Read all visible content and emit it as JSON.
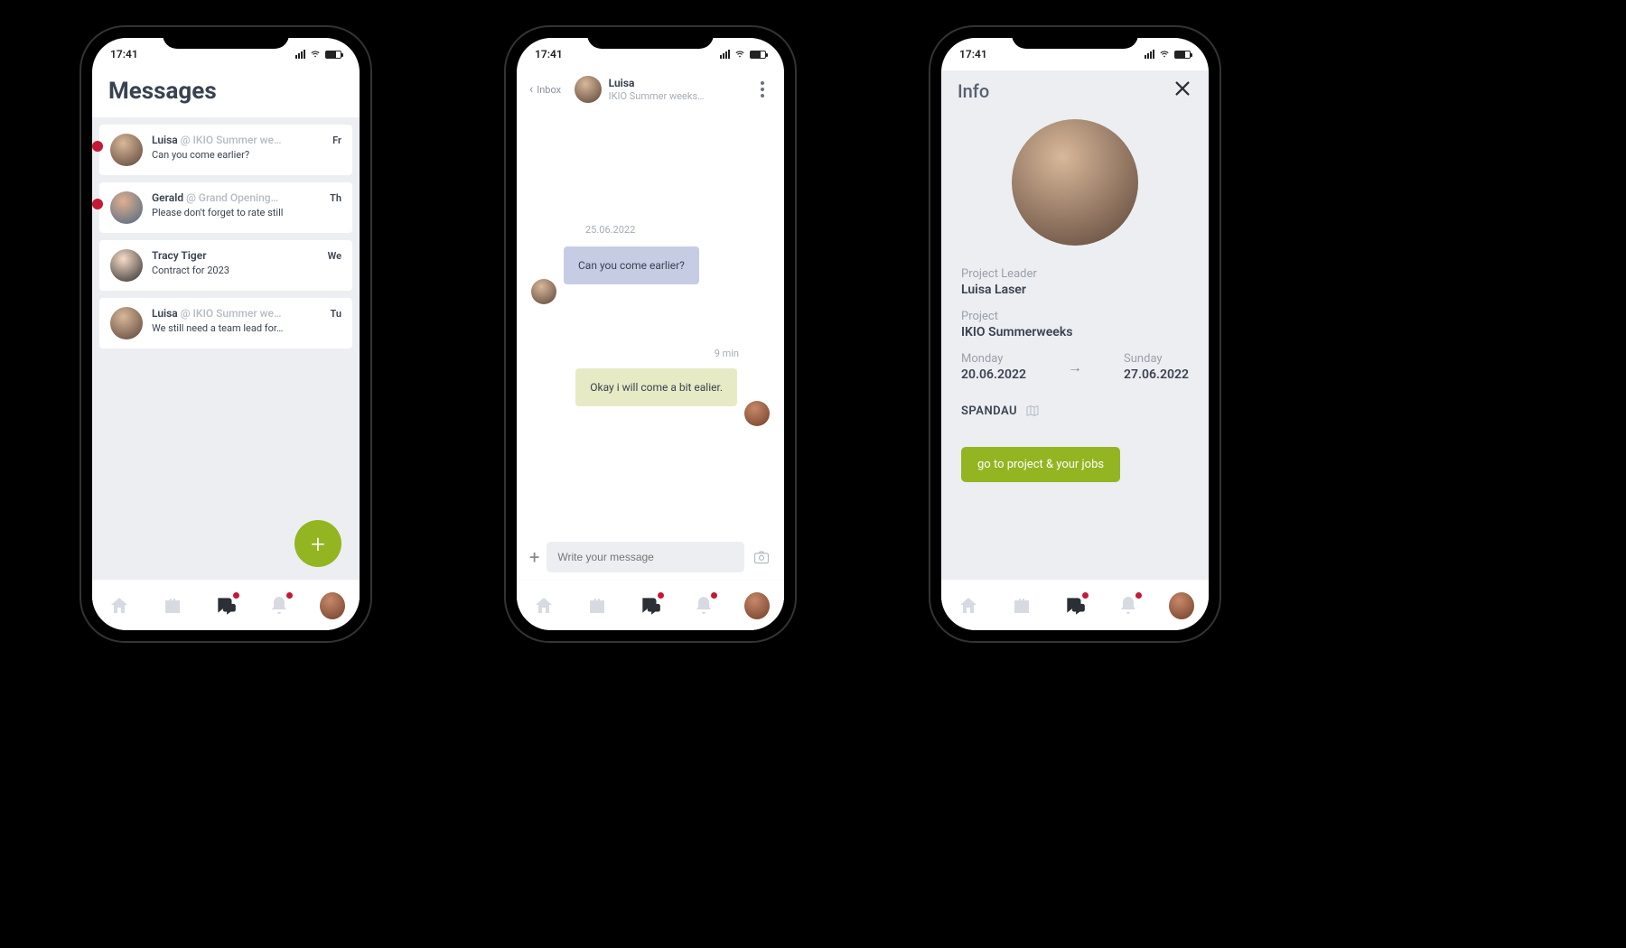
{
  "status_time": "17:41",
  "phone1": {
    "title": "Messages",
    "fab_icon": "+",
    "messages": [
      {
        "name": "Luisa",
        "context": "@ IKIO Summer we…",
        "day": "Fr",
        "preview": "Can you come earlier?",
        "unread": true,
        "avatar": "luisa"
      },
      {
        "name": "Gerald",
        "context": "@ Grand Opening…",
        "day": "Th",
        "preview": "Please don't forget to rate still",
        "unread": true,
        "avatar": "gerald"
      },
      {
        "name": "Tracy Tiger",
        "context": "",
        "day": "We",
        "preview": "Contract for 2023",
        "unread": false,
        "avatar": "tracy"
      },
      {
        "name": "Luisa",
        "context": "@ IKIO Summer we…",
        "day": "Tu",
        "preview": "We still need a team lead for…",
        "unread": false,
        "avatar": "luisa"
      }
    ]
  },
  "phone2": {
    "back_label": "Inbox",
    "user_name": "Luisa",
    "user_sub": "IKIO Summer weeks…",
    "date_label": "25.06.2022",
    "bubble1": "Can you come earlier?",
    "time_label": "9 min",
    "bubble2": "Okay i will come a bit ealier.",
    "composer_placeholder": "Write your message"
  },
  "phone3": {
    "title": "Info",
    "leader_label": "Project Leader",
    "leader_value": "Luisa Laser",
    "project_label": "Project",
    "project_value": "IKIO Summerweeks",
    "start_day": "Monday",
    "start_date": "20.06.2022",
    "end_day": "Sunday",
    "end_date": "27.06.2022",
    "location": "SPANDAU",
    "button_label": "go to project & your jobs"
  },
  "nav": {
    "items": [
      "home",
      "briefcase",
      "chat",
      "bell",
      "profile"
    ]
  }
}
